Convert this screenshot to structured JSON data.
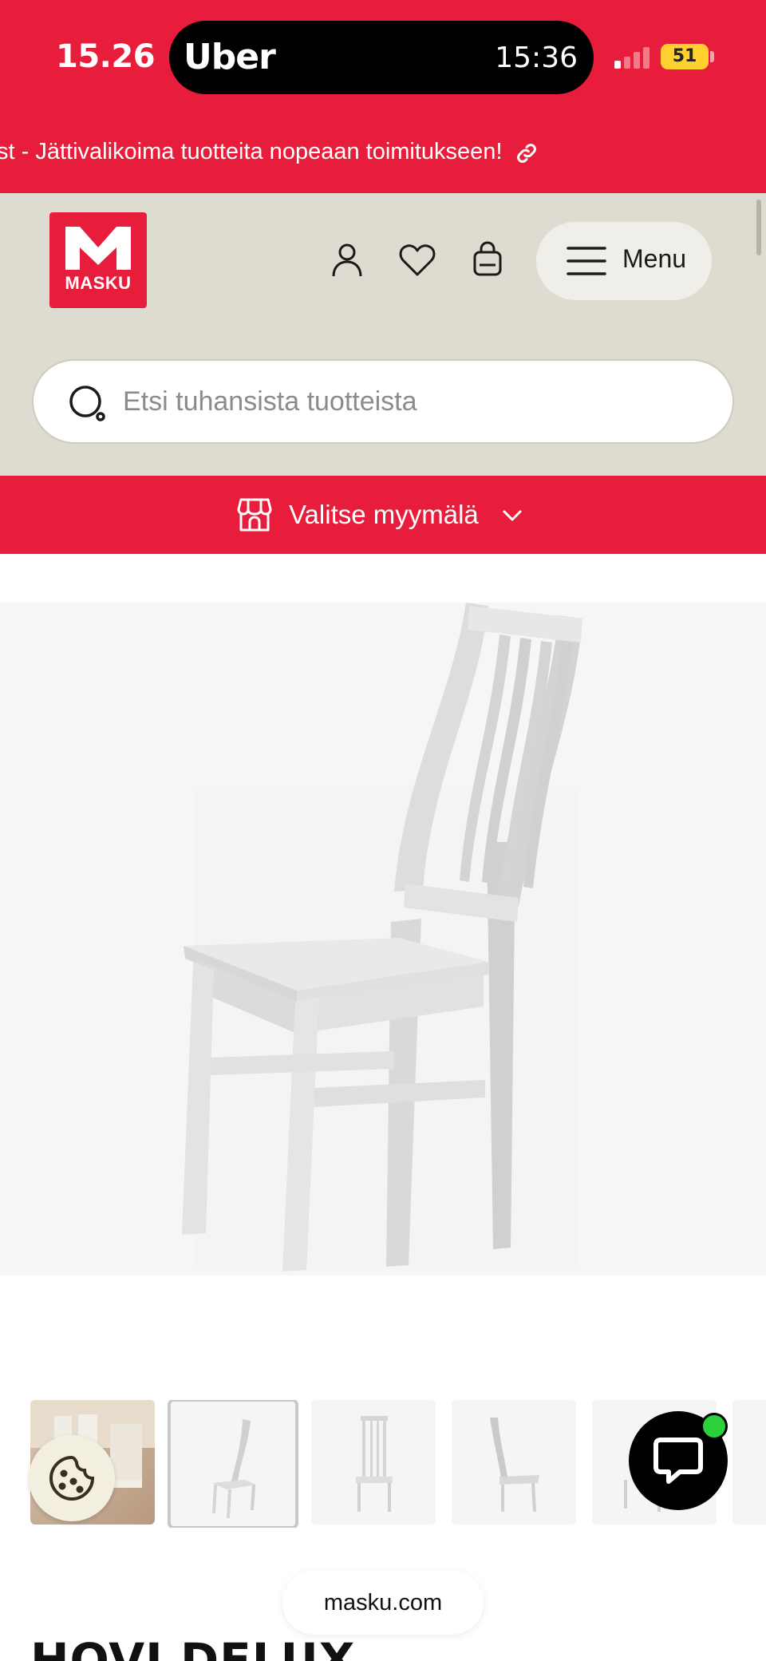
{
  "status_bar": {
    "time": "15.26",
    "live_activity_app": "Uber",
    "live_activity_time": "15:36",
    "battery": "51"
  },
  "promo_banner": {
    "text": "st - Jättivalikoima tuotteita nopeaan toimitukseen!",
    "icon": "link-icon"
  },
  "header": {
    "logo_text": "MASKU",
    "icons": [
      "user-icon",
      "heart-icon",
      "bag-icon"
    ],
    "menu_label": "Menu"
  },
  "search": {
    "placeholder": "Etsi tuhansista tuotteista",
    "value": ""
  },
  "store_selector": {
    "label": "Valitse myymälä",
    "icon": "store-icon"
  },
  "gallery": {
    "thumbnail_count_visible": 6,
    "active_index": 1
  },
  "browser": {
    "url": "masku.com"
  },
  "product": {
    "title": "HOVI DELUX"
  },
  "colors": {
    "brand_red": "#e81d3c",
    "header_beige": "#dedbd0",
    "chat_online": "#2ad13b"
  }
}
